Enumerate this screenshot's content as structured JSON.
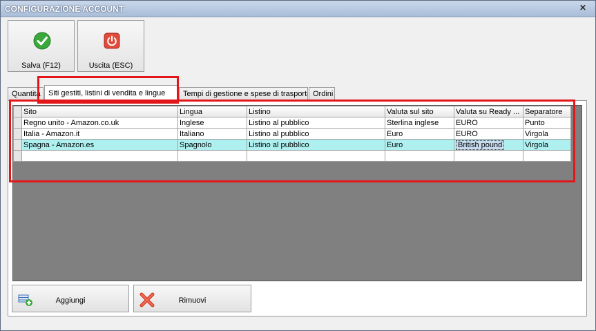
{
  "window": {
    "title": "CONFIGURAZIONE ACCOUNT",
    "close_glyph": "×"
  },
  "toolbar": {
    "save_label": "Salva (F12)",
    "save_icon": "check-icon",
    "exit_label": "Uscita (ESC)",
    "exit_icon": "power-icon"
  },
  "tabs": [
    {
      "label": "Quantità"
    },
    {
      "label": "Siti gestiti, listini di vendita e lingue"
    },
    {
      "label": "Tempi di gestione e spese di trasporto"
    },
    {
      "label": "Ordini"
    }
  ],
  "grid": {
    "columns": [
      "Sito",
      "Lingua",
      "Listino",
      "Valuta sul sito",
      "Valuta su Ready ...",
      "Separatore"
    ],
    "rows": [
      [
        "Regno unito - Amazon.co.uk",
        "Inglese",
        "Listino al pubblico",
        "Sterlina inglese",
        "EURO",
        "Punto"
      ],
      [
        "Italia - Amazon.it",
        "Italiano",
        "Listino al pubblico",
        "Euro",
        "EURO",
        "Virgola"
      ],
      [
        "Spagna - Amazon.es",
        "Spagnolo",
        "Listino al pubblico",
        "Euro",
        "British pound",
        "Virgola"
      ]
    ]
  },
  "buttons": {
    "add_label": "Aggiungi",
    "add_icon": "add-row-icon",
    "remove_label": "Rimuovi",
    "remove_icon": "remove-x-icon"
  },
  "colors": {
    "highlight": "#e3161a",
    "selected_row": "#aef0f0",
    "grid_background": "#808080"
  }
}
